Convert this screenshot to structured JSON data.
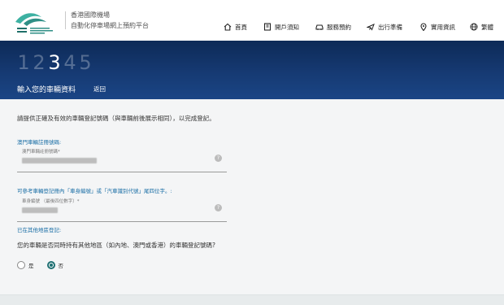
{
  "header": {
    "brand_title": "香港國際機場",
    "brand_subtitle": "自動化停車場網上預約平台",
    "nav": [
      {
        "label": "首頁",
        "icon": "home-icon"
      },
      {
        "label": "開戶須知",
        "icon": "document-icon"
      },
      {
        "label": "服務預約",
        "icon": "car-icon"
      },
      {
        "label": "出行準備",
        "icon": "plane-icon"
      },
      {
        "label": "實用資訊",
        "icon": "location-pin-icon"
      },
      {
        "label": "繁體",
        "icon": "globe-icon"
      }
    ]
  },
  "banner": {
    "steps": [
      "1",
      "2",
      "3",
      "4",
      "5"
    ],
    "current_step": "3",
    "title": "輸入您的車輛資料",
    "back_label": "返回"
  },
  "form": {
    "intro": "請提供正確及有效的車輛登記號碼（與車輛前後展示相同），以完成登記。",
    "macau_section_label": "澳門車輛註冊號碼:",
    "macau_field_placeholder": "澳門車輛註冊號碼*",
    "chassis_section_label": "可參考車輛登記冊內「車身編號」或「汽車識別代號」尾四位字。:",
    "chassis_field_placeholder": "車身編號 （最後四位數字）*",
    "other_region_label": "已在其他地區登記:",
    "question": "您的車輛是否同時持有其他地區（如內地、澳門或香港）的車輛登記號碼?",
    "options": [
      {
        "label": "是",
        "selected": false
      },
      {
        "label": "否",
        "selected": true
      }
    ]
  },
  "colors": {
    "banner": "#163a73",
    "accent_teal": "#1e6f72",
    "link_blue": "#1b6fa6"
  }
}
